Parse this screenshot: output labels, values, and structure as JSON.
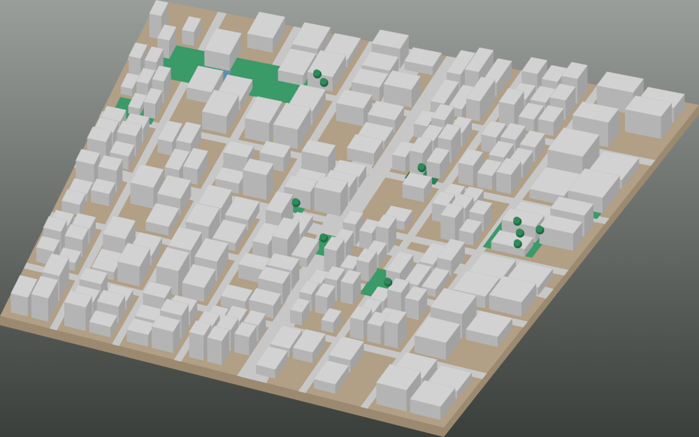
{
  "scene": {
    "kind": "3d-city-block-model",
    "background": {
      "top": "#9a9e9a",
      "bottom": "#3b3f3b"
    },
    "colors": {
      "ground": "#b19f86",
      "ground_side": "#9c8a70",
      "road": "#c7c7c7",
      "building_roof": "#d2d2d2",
      "building_wall_left": "#b4b4b4",
      "building_wall_right": "#a2a2a2",
      "park": "#3a9a68",
      "park_dark": "#2e8056",
      "tree": "#2f8a5a",
      "tree_shade": "#1f6a42",
      "water": "#5f8fa8"
    }
  }
}
